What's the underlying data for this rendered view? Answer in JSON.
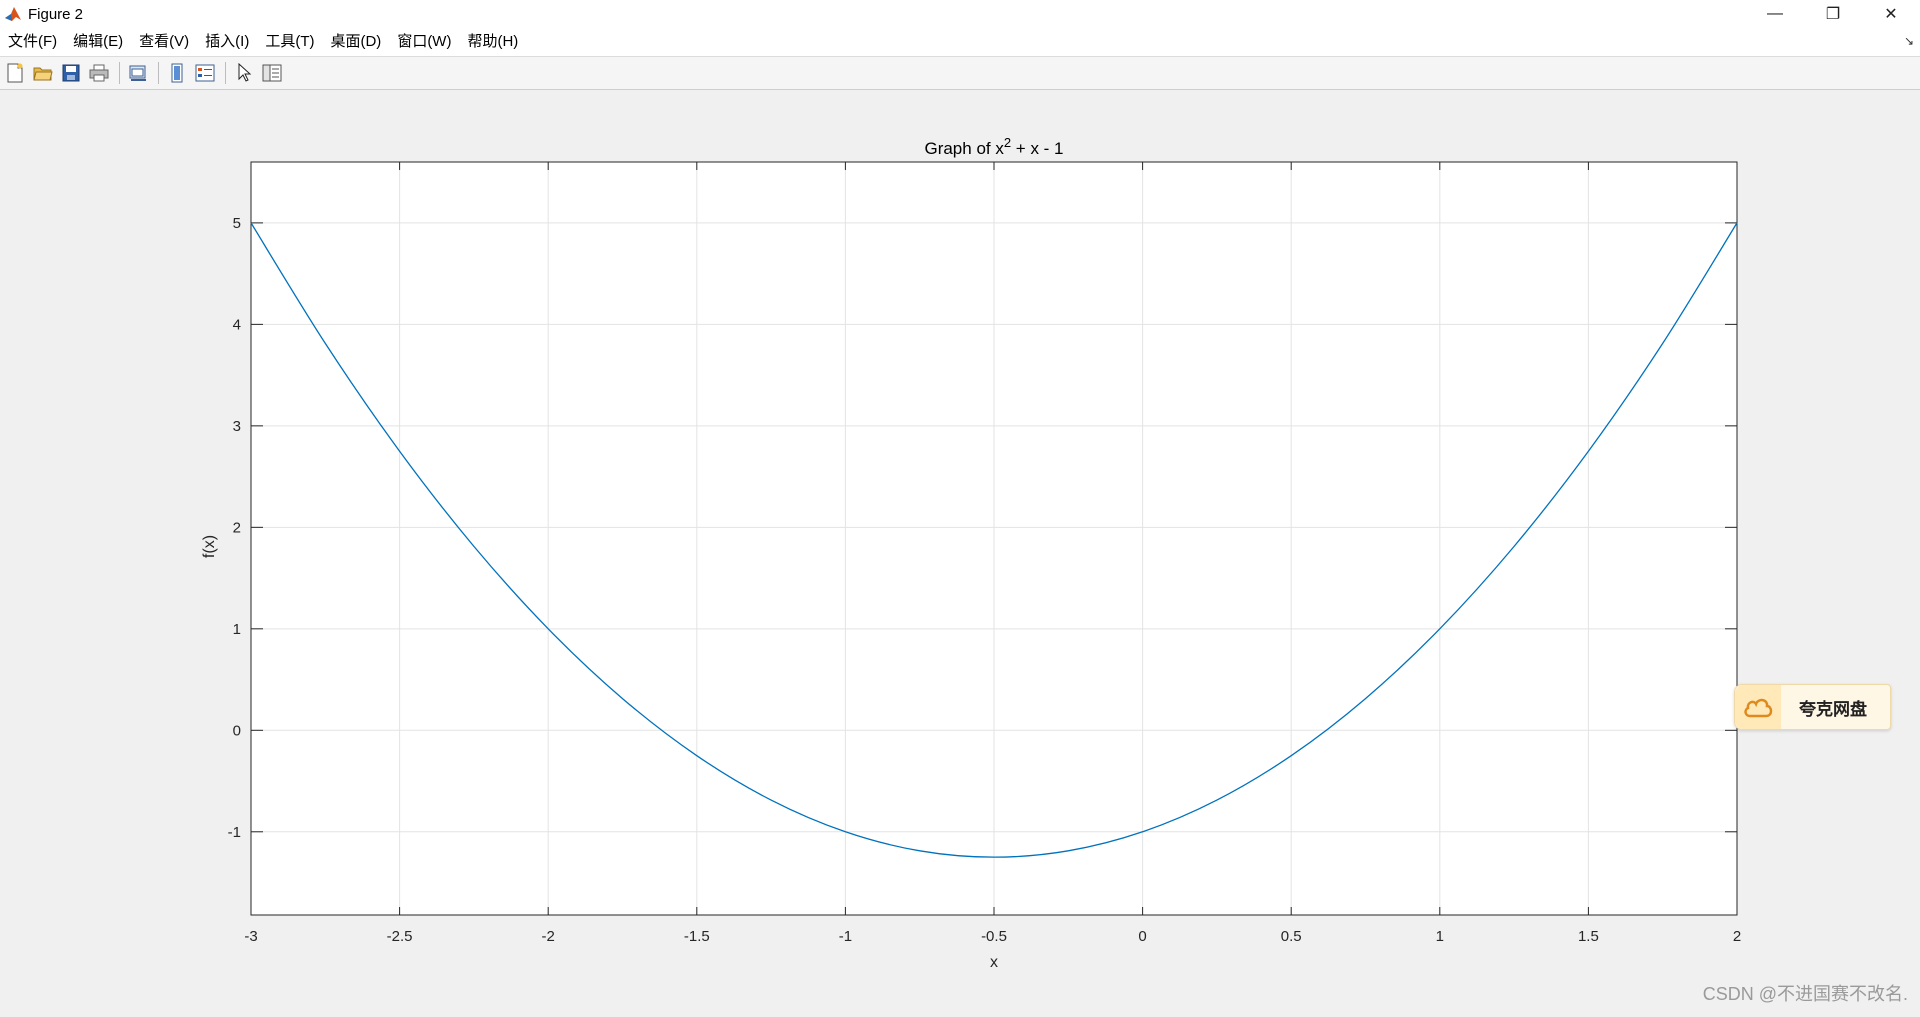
{
  "window": {
    "title": "Figure 2",
    "controls": {
      "minimize": "—",
      "restore": "❐",
      "close": "✕"
    }
  },
  "menu": {
    "items": [
      "文件(F)",
      "编辑(E)",
      "查看(V)",
      "插入(I)",
      "工具(T)",
      "桌面(D)",
      "窗口(W)",
      "帮助(H)"
    ],
    "arrow": "↘"
  },
  "toolbar": {
    "buttons": [
      "new-figure-icon",
      "open-file-icon",
      "save-icon",
      "print-icon",
      "link-plot-icon",
      "colorbar-icon",
      "legend-icon",
      "edit-plot-arrow-icon",
      "property-inspector-icon"
    ]
  },
  "chart_data": {
    "type": "line",
    "title_main": "Graph of x",
    "title_sup": "2",
    "title_rest": " + x - 1",
    "xlabel": "x",
    "ylabel": "f(x)",
    "xlim": [
      -3,
      2
    ],
    "ylim": [
      -1.82,
      5.6
    ],
    "x_ticks": [
      -3,
      -2.5,
      -2,
      -1.5,
      -1,
      -0.5,
      0,
      0.5,
      1,
      1.5,
      2
    ],
    "x_tick_labels": [
      "-3",
      "-2.5",
      "-2",
      "-1.5",
      "-1",
      "-0.5",
      "0",
      "0.5",
      "1",
      "1.5",
      "2"
    ],
    "y_ticks": [
      -1,
      0,
      1,
      2,
      3,
      4,
      5
    ],
    "y_tick_labels": [
      "-1",
      "0",
      "1",
      "2",
      "3",
      "4",
      "5"
    ],
    "grid": true,
    "series": [
      {
        "color": "#0072bd",
        "x": [
          -3,
          -2.75,
          -2.5,
          -2.25,
          -2,
          -1.75,
          -1.5,
          -1.25,
          -1,
          -0.75,
          -0.5,
          -0.25,
          0,
          0.25,
          0.5,
          0.75,
          1,
          1.25,
          1.5,
          1.75,
          2
        ],
        "y": [
          5,
          3.8125,
          2.75,
          1.8125,
          1,
          0.3125,
          -0.25,
          -0.6875,
          -1,
          -1.1875,
          -1.25,
          -1.1875,
          -1,
          -0.6875,
          -0.25,
          0.3125,
          1,
          1.8125,
          2.75,
          3.8125,
          5
        ]
      }
    ]
  },
  "overlay": {
    "quark_label": "夸克网盘",
    "watermark": "CSDN @不进国赛不改名."
  }
}
